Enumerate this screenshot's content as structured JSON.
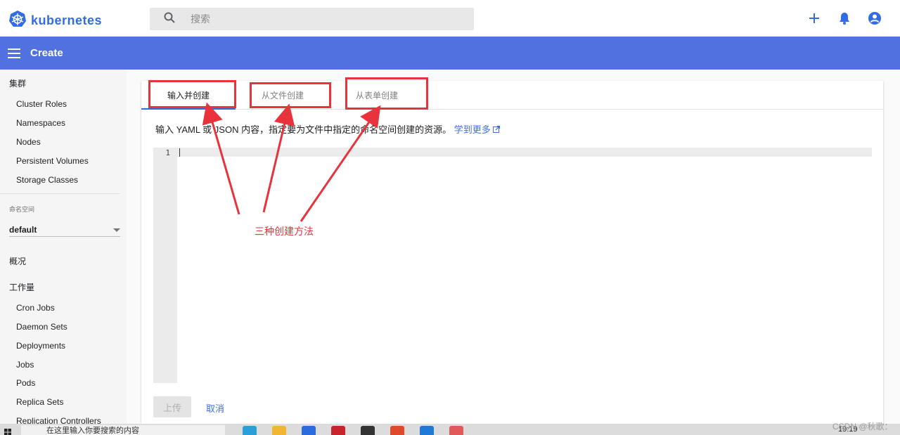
{
  "header": {
    "logo_text": "kubernetes",
    "search_placeholder": "搜索",
    "logo_icon": "kubernetes-helm-icon",
    "action_icons": [
      "add-icon",
      "bell-icon",
      "account-icon"
    ]
  },
  "appbar": {
    "title": "Create",
    "menu_icon": "hamburger-menu-icon",
    "color": "#5271e1"
  },
  "sidebar": {
    "cluster_header": "集群",
    "cluster_items": [
      "Cluster Roles",
      "Namespaces",
      "Nodes",
      "Persistent Volumes",
      "Storage Classes"
    ],
    "namespace_label": "命名空间",
    "namespace_value": "default",
    "overview": "概况",
    "workloads_header": "工作量",
    "workload_items": [
      "Cron Jobs",
      "Daemon Sets",
      "Deployments",
      "Jobs",
      "Pods",
      "Replica Sets",
      "Replication Controllers"
    ]
  },
  "main": {
    "tabs": [
      {
        "label": "输入并创建",
        "active": true
      },
      {
        "label": "从文件创建",
        "active": false
      },
      {
        "label": "从表单创建",
        "active": false
      }
    ],
    "description": "输入 YAML 或 JSON 内容，指定要为文件中指定的命名空间创建的资源。",
    "learn_more": "学到更多",
    "learn_more_icon": "external-link-icon",
    "editor": {
      "line_numbers": [
        "1"
      ],
      "content": ""
    },
    "upload_button": "上传",
    "cancel_button": "取消",
    "accent": "#326ce5"
  },
  "annotation": {
    "label": "三种创建方法",
    "color": "#e8323c"
  },
  "taskbar": {
    "search_text": "在这里输入你要搜索的内容",
    "clock": "19:19"
  },
  "watermark": "CSDN @秋歌："
}
